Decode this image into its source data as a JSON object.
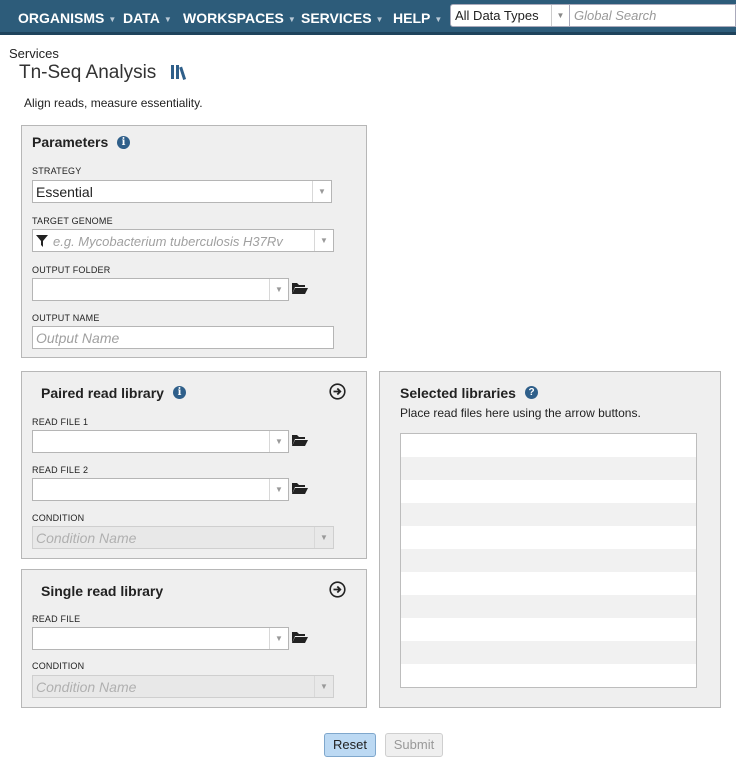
{
  "nav": {
    "items": [
      {
        "label": "ORGANISMS"
      },
      {
        "label": "DATA"
      },
      {
        "label": "WORKSPACES"
      },
      {
        "label": "SERVICES"
      },
      {
        "label": "HELP"
      }
    ],
    "data_type_select": "All Data Types",
    "search_placeholder": "Global Search"
  },
  "breadcrumb": "Services",
  "page": {
    "title": "Tn-Seq Analysis",
    "subtitle": "Align reads, measure essentiality."
  },
  "parameters": {
    "title": "Parameters",
    "strategy_label": "STRATEGY",
    "strategy_value": "Essential",
    "genome_label": "TARGET GENOME",
    "genome_placeholder": "e.g. Mycobacterium tuberculosis H37Rv",
    "output_folder_label": "OUTPUT FOLDER",
    "output_folder_value": "",
    "output_name_label": "OUTPUT NAME",
    "output_name_placeholder": "Output Name"
  },
  "paired": {
    "title": "Paired read library",
    "read1_label": "READ FILE 1",
    "read2_label": "READ FILE 2",
    "condition_label": "CONDITION",
    "condition_placeholder": "Condition Name"
  },
  "single": {
    "title": "Single read library",
    "read_label": "READ FILE",
    "condition_label": "CONDITION",
    "condition_placeholder": "Condition Name"
  },
  "selected": {
    "title": "Selected libraries",
    "hint": "Place read files here using the arrow buttons."
  },
  "buttons": {
    "reset": "Reset",
    "submit": "Submit"
  },
  "colors": {
    "nav_bg": "#2d5c7a",
    "accent": "#2f5f8a",
    "reset_bg": "#bcd9f3"
  }
}
